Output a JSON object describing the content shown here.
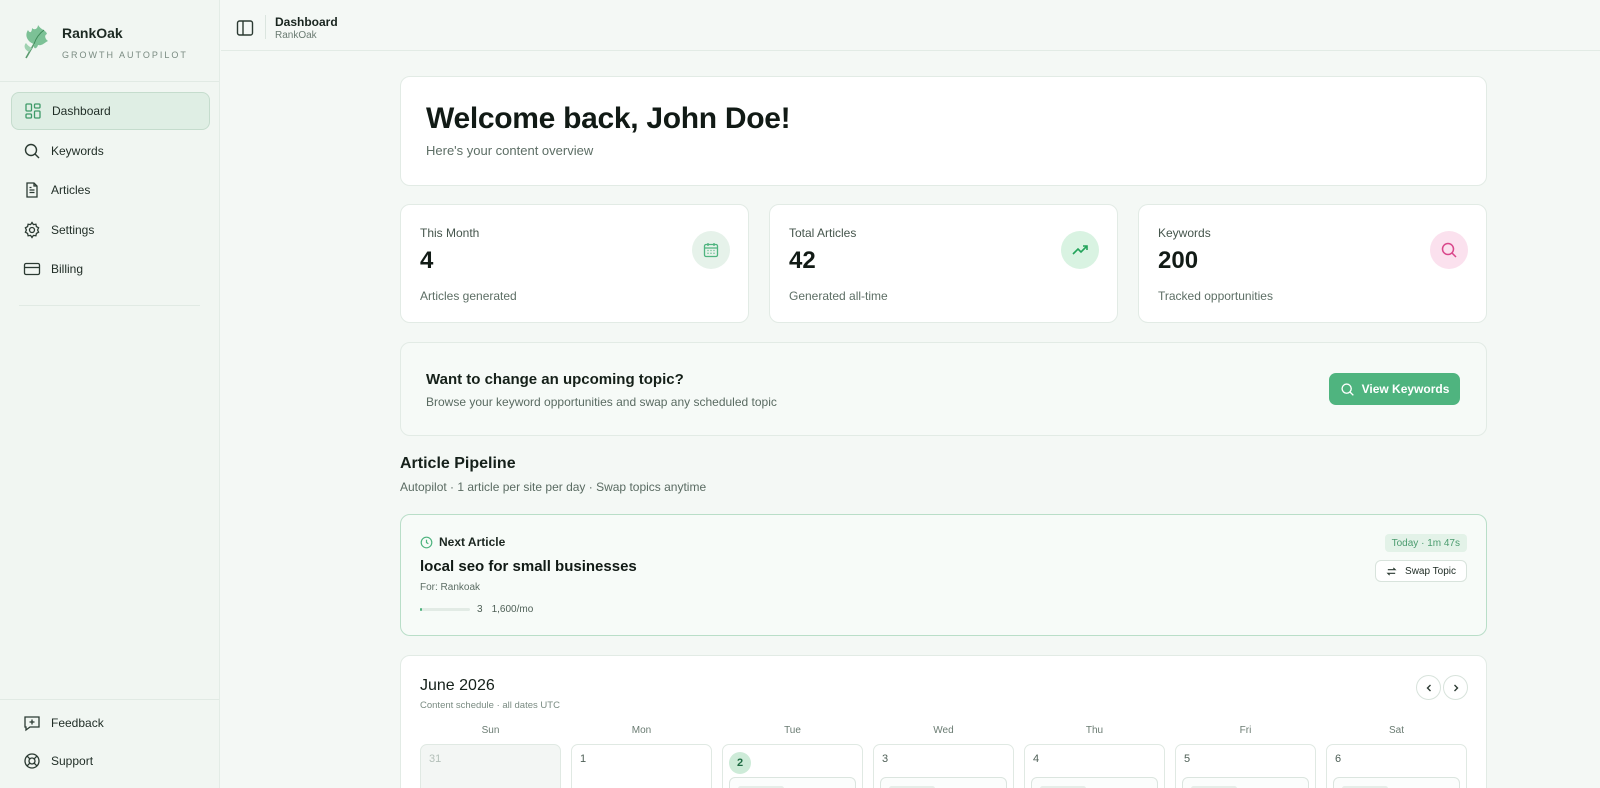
{
  "brand": {
    "name": "RankOak",
    "tagline": "GROWTH AUTOPILOT"
  },
  "nav": {
    "items": [
      {
        "label": "Dashboard",
        "icon": "dashboard-icon",
        "active": true
      },
      {
        "label": "Keywords",
        "icon": "search-icon"
      },
      {
        "label": "Articles",
        "icon": "document-icon"
      },
      {
        "label": "Settings",
        "icon": "gear-icon"
      },
      {
        "label": "Billing",
        "icon": "credit-card-icon"
      }
    ],
    "bottom": [
      {
        "label": "Feedback",
        "icon": "feedback-icon"
      },
      {
        "label": "Support",
        "icon": "lifebuoy-icon"
      }
    ]
  },
  "header": {
    "title": "Dashboard",
    "subtitle": "RankOak"
  },
  "welcome": {
    "title": "Welcome back, John Doe!",
    "subtitle": "Here's your content overview"
  },
  "stats": [
    {
      "label": "This Month",
      "value": "4",
      "desc": "Articles generated",
      "icon": "calendar-icon",
      "accent": "#4fb47f"
    },
    {
      "label": "Total Articles",
      "value": "42",
      "desc": "Generated all-time",
      "icon": "trending-up-icon",
      "accent": "#22a35a"
    },
    {
      "label": "Keywords",
      "value": "200",
      "desc": "Tracked opportunities",
      "icon": "search-icon",
      "accent": "#d9468a"
    }
  ],
  "topic_banner": {
    "title": "Want to change an upcoming topic?",
    "subtitle": "Browse your keyword opportunities and swap any scheduled topic",
    "button": "View Keywords"
  },
  "pipeline": {
    "title": "Article Pipeline",
    "subtitle": "Autopilot · 1 article per site per day · Swap topics anytime"
  },
  "next_article": {
    "heading": "Next Article",
    "title": "local seo for small businesses",
    "for": "For: Rankoak",
    "difficulty": "3",
    "difficulty_fraction": 0.03,
    "volume": "1,600/mo",
    "time": "Today · 1m 47s",
    "swap_label": "Swap Topic"
  },
  "calendar": {
    "month": "June 2026",
    "subtitle": "Content schedule · all dates UTC",
    "weekdays": [
      "Sun",
      "Mon",
      "Tue",
      "Wed",
      "Thu",
      "Fri",
      "Sat"
    ],
    "days": [
      "31",
      "1",
      "2",
      "3",
      "4",
      "5",
      "6"
    ],
    "today": "2"
  },
  "colors": {
    "accent": "#4fb47f",
    "sidebar_bg": "#f1f6f2",
    "page_bg": "#f4f8f5"
  }
}
